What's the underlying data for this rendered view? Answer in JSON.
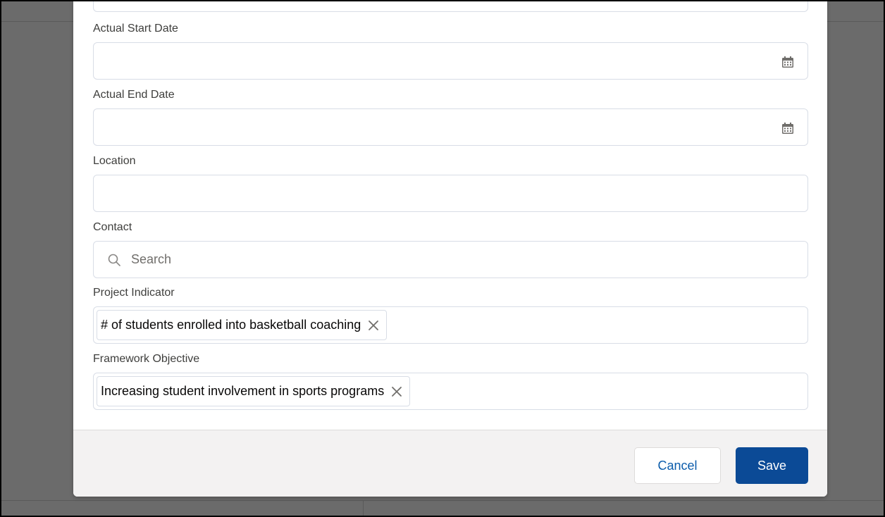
{
  "form": {
    "actual_start_date": {
      "label": "Actual Start Date",
      "value": ""
    },
    "actual_end_date": {
      "label": "Actual End Date",
      "value": ""
    },
    "location": {
      "label": "Location",
      "value": ""
    },
    "contact": {
      "label": "Contact",
      "placeholder": "Search"
    },
    "project_indicator": {
      "label": "Project Indicator",
      "selected": "# of students enrolled into basketball coaching"
    },
    "framework_objective": {
      "label": "Framework Objective",
      "selected": "Increasing student involvement in sports programs"
    }
  },
  "footer": {
    "cancel_label": "Cancel",
    "save_label": "Save"
  },
  "icons": {
    "date_picker": "calendar-icon",
    "lookup": "search-icon",
    "remove_selection": "close-icon"
  },
  "colors": {
    "overlay": "#6b6b6b",
    "save_button": "#0b4a96",
    "cancel_text": "#0b5cab",
    "input_border": "#d8dde6"
  }
}
